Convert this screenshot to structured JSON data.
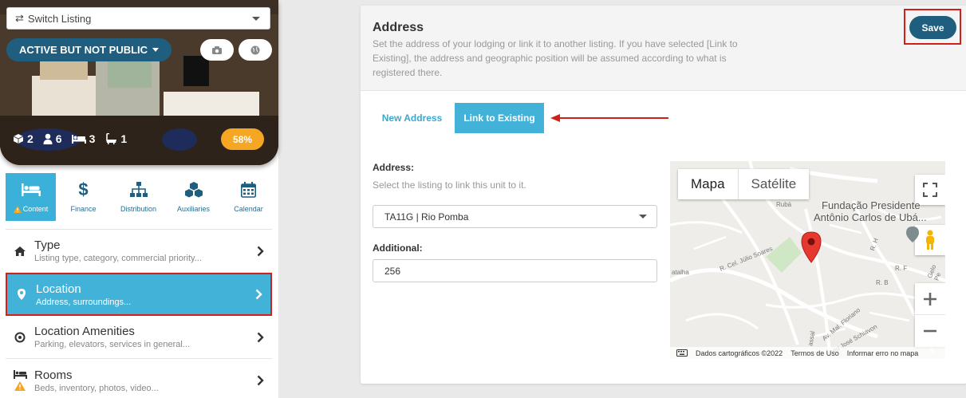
{
  "sidebar": {
    "switch_label": "Switch Listing",
    "status_label": "ACTIVE BUT NOT PUBLIC",
    "stats": {
      "units": "2",
      "guests": "6",
      "beds": "3",
      "baths": "1"
    },
    "completion": "58%",
    "tabs": [
      {
        "label": "Content",
        "active": true
      },
      {
        "label": "Finance"
      },
      {
        "label": "Distribution"
      },
      {
        "label": "Auxiliaries"
      },
      {
        "label": "Calendar"
      }
    ],
    "menu": [
      {
        "title": "Type",
        "subtitle": "Listing type, category, commercial priority..."
      },
      {
        "title": "Location",
        "subtitle": "Address, surroundings..."
      },
      {
        "title": "Location Amenities",
        "subtitle": "Parking, elevators, services in general..."
      },
      {
        "title": "Rooms",
        "subtitle": "Beds, inventory, photos, video..."
      }
    ]
  },
  "main": {
    "title": "Address",
    "description": "Set the address of your lodging or link it to another listing. If you have selected [Link to Existing], the address and geographic position will be assumed according to what is registered there.",
    "save_label": "Save",
    "tab_new": "New Address",
    "tab_link": "Link to Existing",
    "address_label": "Address:",
    "address_help": "Select the listing to link this unit to it.",
    "address_value": "TA11G | Rio Pomba",
    "additional_label": "Additional:",
    "additional_value": "256"
  },
  "map": {
    "type_map": "Mapa",
    "type_satellite": "Satélite",
    "place_line1": "Fundação Presidente",
    "place_line2": "Antônio Carlos de Ubá...",
    "footer_data": "Dados cartográficos ©2022",
    "footer_terms": "Termos de Uso",
    "footer_report": "Informar erro no mapa",
    "streets": [
      "R. Cel. Júlio Soares",
      "Av. Mal. Floriano",
      "eu José Schiavon",
      "R. B",
      "R. F",
      "R. H",
      "atalha",
      "Rubá",
      "Gelo Pe",
      "assal"
    ]
  },
  "colors": {
    "accent": "#42b2d9",
    "primary": "#1f5e7e",
    "highlight": "#d0201a",
    "warning": "#f5a623"
  }
}
